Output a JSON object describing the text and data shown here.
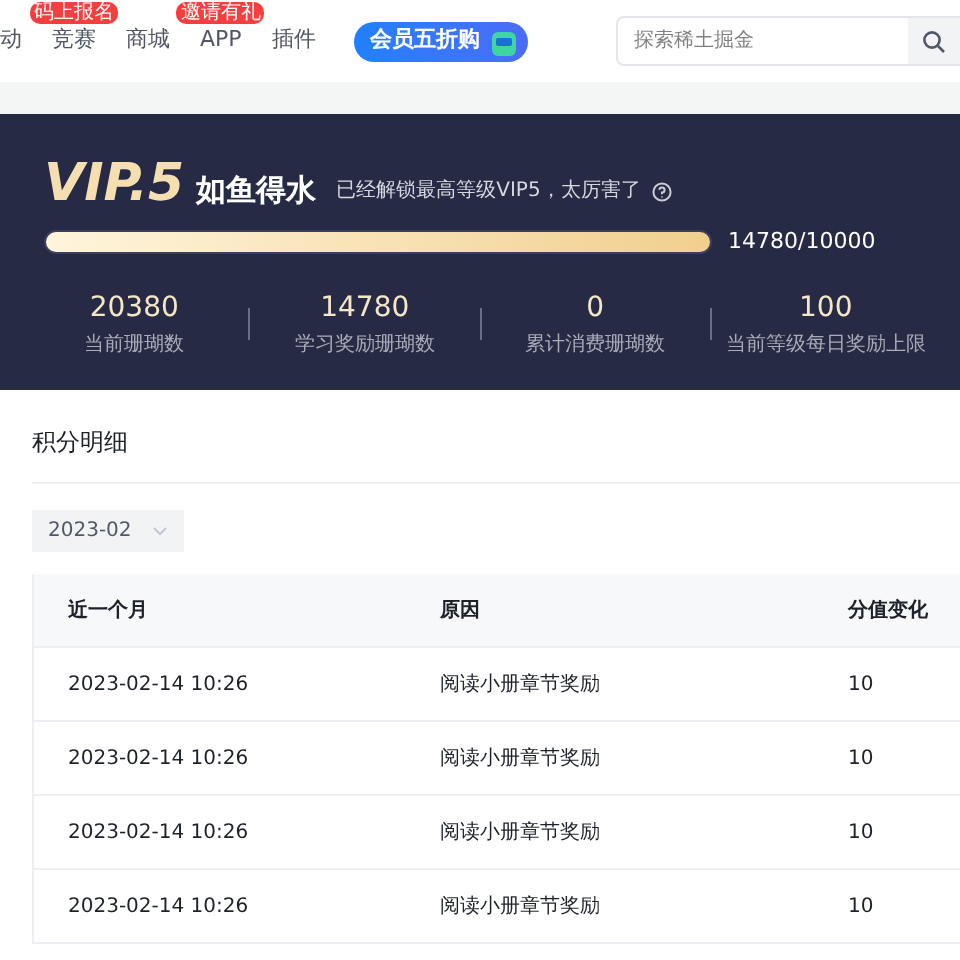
{
  "nav": {
    "items": [
      {
        "label": "动"
      },
      {
        "label": "竞赛",
        "badge": "码上报名"
      },
      {
        "label": "商城"
      },
      {
        "label": "APP",
        "badge": "邀请有礼"
      },
      {
        "label": "插件"
      }
    ],
    "promo": "会员五折购",
    "search": {
      "placeholder": "探索稀土掘金"
    }
  },
  "vip": {
    "level": "VIP.5",
    "title": "如鱼得水",
    "subtitle": "已经解锁最高等级VIP5，太厉害了",
    "progress": {
      "level": 1,
      "reading": "14780/10000"
    },
    "stats": [
      {
        "value": "20380",
        "label": "当前珊瑚数"
      },
      {
        "value": "14780",
        "label": "学习奖励珊瑚数"
      },
      {
        "value": "0",
        "label": "累计消费珊瑚数"
      },
      {
        "value": "100",
        "label": "当前等级每日奖励上限"
      }
    ]
  },
  "details": {
    "title": "积分明细",
    "month": "2023-02",
    "table": {
      "columns": [
        "近一个月",
        "原因",
        "分值变化"
      ],
      "rows": [
        [
          "2023-02-14 10:26",
          "阅读小册章节奖励",
          "10"
        ],
        [
          "2023-02-14 10:26",
          "阅读小册章节奖励",
          "10"
        ],
        [
          "2023-02-14 10:26",
          "阅读小册章节奖励",
          "10"
        ],
        [
          "2023-02-14 10:26",
          "阅读小册章节奖励",
          "10"
        ]
      ]
    }
  }
}
